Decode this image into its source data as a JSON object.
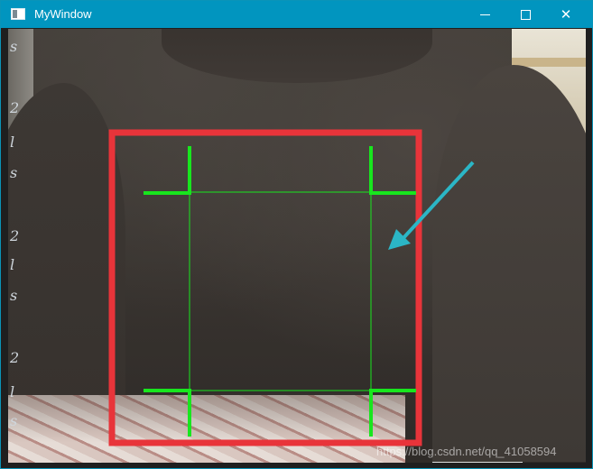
{
  "window": {
    "title": "MyWindow",
    "icon": "app-window-icon",
    "minimize_icon": "minimize-icon",
    "maximize_icon": "maximize-icon",
    "close_icon": "close-icon",
    "close_glyph": "✕"
  },
  "background_texts": [
    "s",
    "2",
    "l",
    "s",
    "2",
    "l",
    "s",
    "2",
    "l",
    "s"
  ],
  "overlay": {
    "detection_box_color": "#e8343a",
    "roi_line_color": "#18e61e",
    "arrow_color": "#2bb6c6"
  },
  "watermark": "https://blog.csdn.net/qq_41058594"
}
